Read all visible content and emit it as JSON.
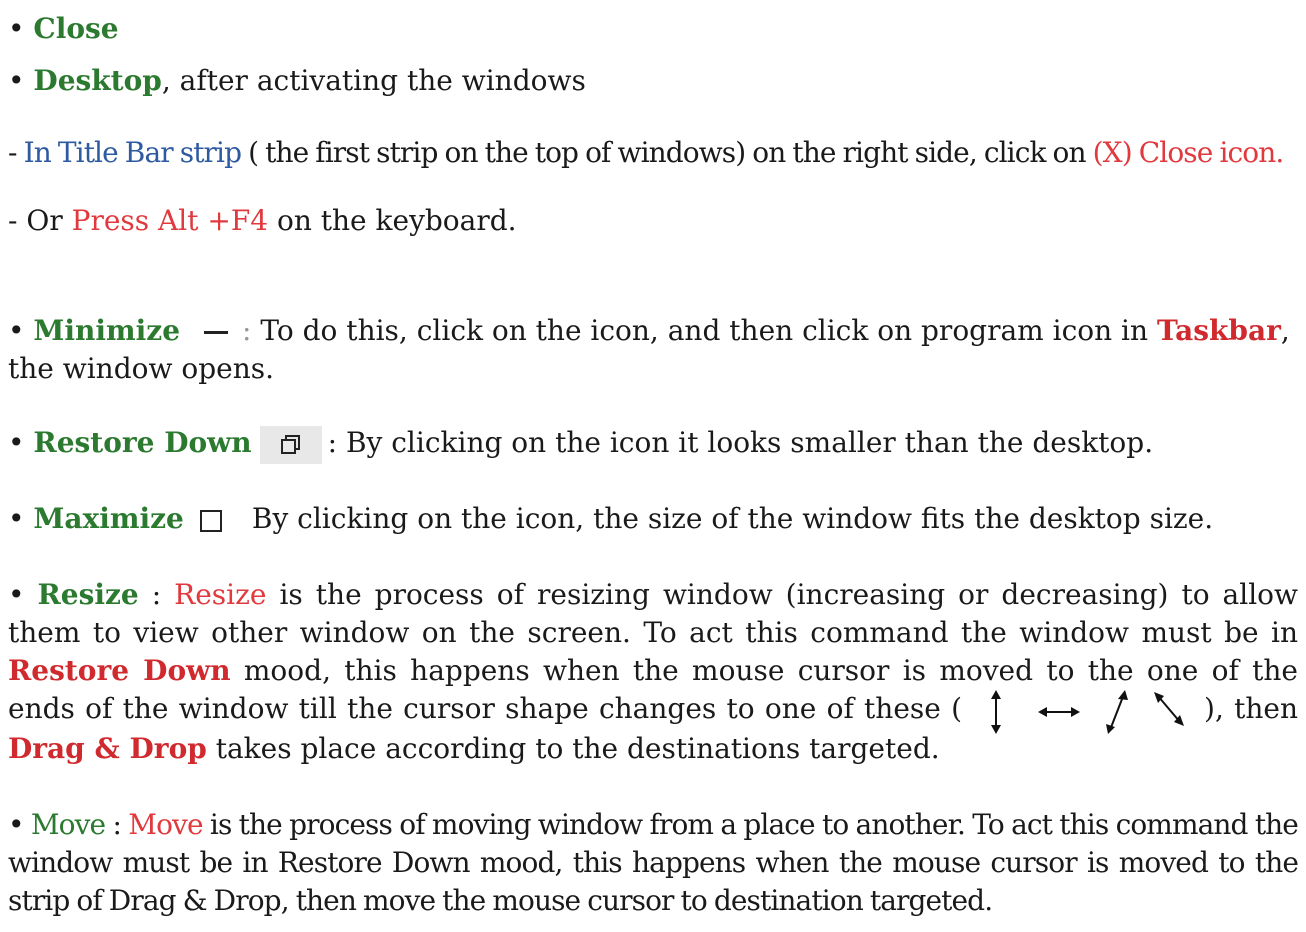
{
  "close": {
    "bullet": "•",
    "title": "Close"
  },
  "desktop": {
    "bullet": "•",
    "title": "Desktop",
    "rest": ", after activating the windows"
  },
  "titlebar": {
    "dash": "- ",
    "link": "In Title Bar strip",
    "mid": " ( the first strip on the top of windows) on the right side, click on ",
    "x": "(X)",
    "space": " ",
    "close_icon": "Close icon."
  },
  "alt": {
    "dash": "- Or ",
    "press": "Press Alt +F4",
    "rest": " on the keyboard."
  },
  "minimize": {
    "bullet": "• ",
    "title": "Minimize",
    "sep": ":",
    "text1": " To do this, click on the icon, and then click on program icon in ",
    "taskbar": "Taskbar",
    "text2": ",",
    "line2": "the window opens."
  },
  "restore": {
    "bullet": "• ",
    "title": "Restore Down",
    "text": ": By clicking on the icon it looks smaller than the desktop."
  },
  "maximize": {
    "bullet": "• ",
    "title": "Maximize",
    "text": "By clicking on the icon, the size of the window fits the desktop size."
  },
  "resize": {
    "bullet": "• ",
    "title": "Resize",
    "colon": " : ",
    "word": "Resize",
    "text1": " is the process of resizing window (increasing or decreasing) to allow them to view other window on the screen. To act this command the window must be in ",
    "restore_down": "Restore Down",
    "text2": " mood, this happens when the mouse cursor is moved to the one of the ends of the window till the cursor shape changes to one of these (",
    "text3": "), then ",
    "drag_drop": "Drag & Drop",
    "text4": " takes place according to the destinations targeted."
  },
  "move": {
    "bullet": "• ",
    "title": "Move",
    "colon": " : ",
    "word": "Move",
    "text": " is the process of moving window from a place to another. To act this command the window must be in Restore Down mood, this happens when the mouse cursor is moved to the strip of Drag & Drop, then move the mouse cursor to destination targeted."
  },
  "icons": [
    "minimize-icon",
    "restore-down-icon",
    "maximize-icon",
    "vertical-resize-cursor-icon",
    "horizontal-resize-cursor-icon",
    "diagonal-resize-cursor-icon",
    "diagonal-resize-cursor-icon"
  ],
  "colors": {
    "green": "#2b7a2f",
    "red": "#e0393e",
    "blue": "#2d5aa0",
    "text": "#1a1a1a"
  }
}
